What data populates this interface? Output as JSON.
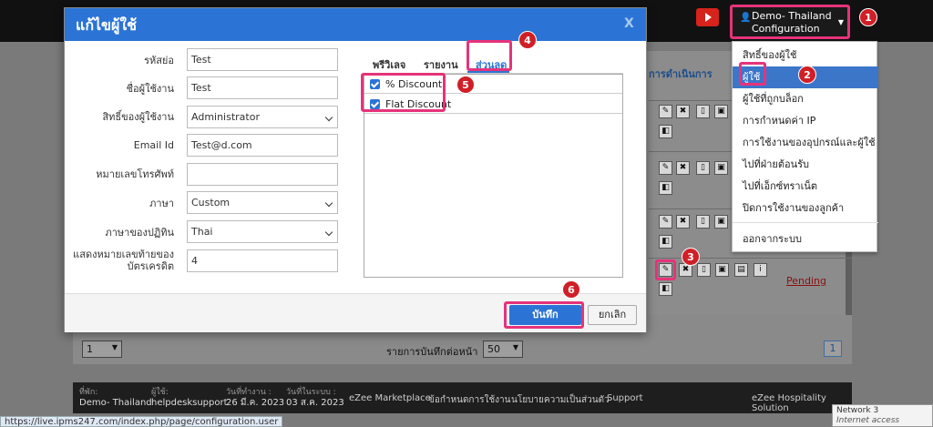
{
  "app": {
    "user_menu_label": "Demo- Thailand Configuration",
    "dropdown": [
      {
        "label": "สิทธิ์ของผู้ใช้",
        "active": false
      },
      {
        "label": "ผู้ใช้",
        "active": true
      },
      {
        "label": "ผู้ใช้ที่ถูกบล็อก",
        "active": false
      },
      {
        "label": "การกำหนดค่า IP",
        "active": false
      },
      {
        "label": "การใช้งานของอุปกรณ์และผู้ใช้",
        "active": false
      },
      {
        "label": "ไปที่ฝ่ายต้อนรับ",
        "active": false
      },
      {
        "label": "ไปที่เอ็กซ์ทราเน็ต",
        "active": false
      },
      {
        "label": "ปิดการใช้งานของลูกค้า",
        "active": false
      },
      {
        "label": "ออกจากระบบ",
        "active": false
      }
    ],
    "actions_header": "การดำเนินการ",
    "pending_label": "Pending"
  },
  "pager": {
    "page_select": "1",
    "records_label": "รายการบันทึกต่อหน้า",
    "records_value": "50",
    "current_page": "1"
  },
  "footer": {
    "property_label": "ที่พัก:",
    "property_value": "Demo- Thailand",
    "user_label": "ผู้ใช้:",
    "user_value": "helpdesksupport",
    "workday_label": "วันที่ทำงาน :",
    "workday_value": "26 มี.ค. 2023",
    "sysdate_label": "วันที่ในระบบ :",
    "sysdate_value": "03 ส.ค. 2023",
    "links": [
      "eZee Marketplace",
      "ข้อกำหนดการใช้งาน",
      "นโยบายความเป็นส่วนตัว",
      "Support"
    ],
    "brand": "eZee Hospitality Solution"
  },
  "status_url": "https://live.ipms247.com/index.php/page/configuration.user",
  "network_tip": {
    "title": "Network 3",
    "subtitle": "Internet access"
  },
  "modal": {
    "title": "แก้ไขผู้ใช้",
    "close": "X",
    "fields": [
      {
        "label": "รหัสย่อ",
        "value": "Test",
        "type": "text"
      },
      {
        "label": "ชื่อผู้ใช้งาน",
        "value": "Test",
        "type": "text"
      },
      {
        "label": "สิทธิ์ของผู้ใช้งาน",
        "value": "Administrator",
        "type": "select"
      },
      {
        "label": "Email Id",
        "value": "Test@d.com",
        "type": "text"
      },
      {
        "label": "หมายเลขโทรศัพท์",
        "value": "",
        "type": "text"
      },
      {
        "label": "ภาษา",
        "value": "Custom",
        "type": "select"
      },
      {
        "label": "ภาษาของปฏิทิน",
        "value": "Thai",
        "type": "select"
      },
      {
        "label": "แสดงหมายเลขท้ายของบัตรเครดิต",
        "value": "4",
        "type": "text"
      }
    ],
    "tabs": [
      {
        "label": "พรีวิเลจ",
        "active": false
      },
      {
        "label": "รายงาน",
        "active": false
      },
      {
        "label": "ส่วนลด",
        "active": true
      }
    ],
    "permissions": [
      {
        "label": "% Discount",
        "checked": true
      },
      {
        "label": "Flat Discount",
        "checked": true
      }
    ],
    "save_label": "บันทึก",
    "cancel_label": "ยกเลิก"
  },
  "badges": [
    "1",
    "2",
    "3",
    "4",
    "5",
    "6"
  ],
  "colors": {
    "accent": "#2b74d6",
    "highlight": "#e6337a",
    "badge": "#d01f27"
  }
}
